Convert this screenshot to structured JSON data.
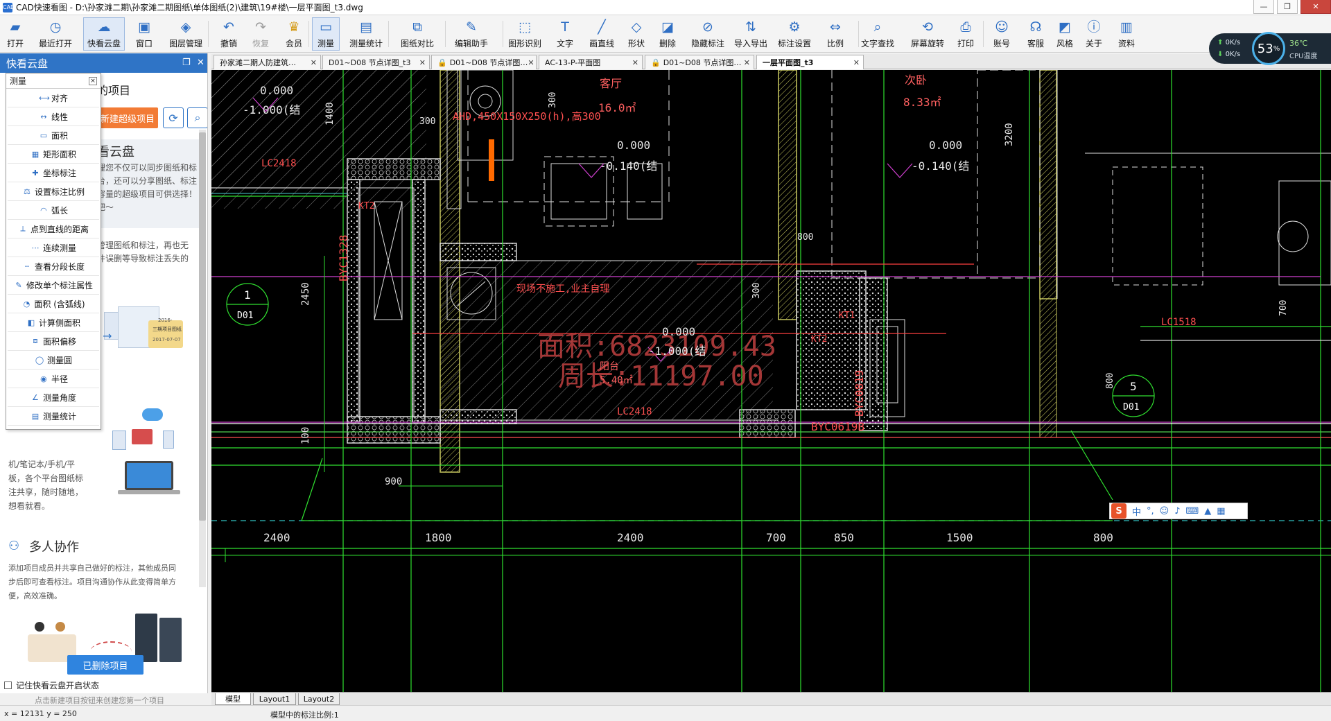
{
  "window": {
    "title": "CAD快速看图 - D:\\孙家滩二期\\孙家滩二期图纸\\单体图纸(2)\\建筑\\19#楼\\一层平面图_t3.dwg",
    "app_icon_text": "CAD"
  },
  "toolbar": {
    "items": [
      {
        "label": "打开",
        "icon": "folder-icon"
      },
      {
        "label": "最近打开",
        "icon": "recent-icon"
      },
      {
        "label": "快看云盘",
        "icon": "cloud-icon"
      },
      {
        "label": "窗口",
        "icon": "window-icon"
      },
      {
        "label": "图层管理",
        "icon": "layers-icon"
      },
      {
        "label": "撤销",
        "icon": "undo-icon"
      },
      {
        "label": "恢复",
        "icon": "redo-icon"
      },
      {
        "label": "会员",
        "icon": "vip-icon"
      },
      {
        "label": "测量",
        "icon": "measure-icon"
      },
      {
        "label": "测量统计",
        "icon": "measure-stats-icon"
      },
      {
        "label": "图纸对比",
        "icon": "compare-icon"
      },
      {
        "label": "编辑助手",
        "icon": "edit-assistant-icon"
      },
      {
        "label": "图形识别",
        "icon": "shape-recognize-icon"
      },
      {
        "label": "文字",
        "icon": "text-icon"
      },
      {
        "label": "画直线",
        "icon": "line-icon"
      },
      {
        "label": "形状",
        "icon": "shape-icon"
      },
      {
        "label": "删除",
        "icon": "eraser-icon"
      },
      {
        "label": "隐藏标注",
        "icon": "hide-annotation-icon"
      },
      {
        "label": "导入导出",
        "icon": "import-export-icon"
      },
      {
        "label": "标注设置",
        "icon": "annotation-settings-icon"
      },
      {
        "label": "比例",
        "icon": "scale-icon"
      },
      {
        "label": "文字查找",
        "icon": "text-search-icon"
      },
      {
        "label": "屏幕旋转",
        "icon": "rotate-screen-icon"
      },
      {
        "label": "打印",
        "icon": "print-icon"
      },
      {
        "label": "账号",
        "icon": "account-icon"
      },
      {
        "label": "客服",
        "icon": "headset-icon"
      },
      {
        "label": "风格",
        "icon": "style-icon"
      },
      {
        "label": "关于",
        "icon": "info-icon"
      },
      {
        "label": "资料",
        "icon": "docs-icon"
      }
    ]
  },
  "sysmon": {
    "up": "0K/s",
    "down": "0K/s",
    "cpu_percent": "53",
    "percent_sign": "%",
    "temp": "36℃",
    "cpu_label": "CPU温度"
  },
  "sidebar": {
    "title": "快看云盘",
    "my_projects": "的项目",
    "new_project": "新建超级项目",
    "heading1": "看云盘",
    "desc1": "理您不仅可以同步图纸和标\n台，还可以分享图纸、标注\n容量的超级项目可供选择！\n吧～",
    "desc2": "管理图纸和标注，再也无\n件误删等导致标注丢失的",
    "illus_card_title": "三期项目图纸",
    "illus_card_date1": "2016-",
    "illus_card_date2": "2017-07-07",
    "desc3": "机/笔记本/手机/平\n板，各个平台图纸标\n注共享，随时随地，\n想看就看。",
    "heading2": "多人协作",
    "desc4": "添加项目成员并共享自己做好的标注，其他成员同\n步后即可查看标注。项目沟通协作从此变得简单方\n便，高效准确。",
    "deleted_btn": "已删除项目",
    "remember": "记住快看云盘开启状态",
    "hint": "点击新建项目按钮来创建您第一个项目"
  },
  "measure_menu": {
    "title": "测量",
    "items": [
      {
        "label": "对齐",
        "icon": "align-measure-icon"
      },
      {
        "label": "线性",
        "icon": "linear-measure-icon"
      },
      {
        "label": "面积",
        "icon": "area-icon"
      },
      {
        "label": "矩形面积",
        "icon": "rect-area-icon"
      },
      {
        "label": "坐标标注",
        "icon": "coordinate-icon"
      },
      {
        "label": "设置标注比例",
        "icon": "set-scale-icon"
      },
      {
        "label": "弧长",
        "icon": "arc-length-icon"
      },
      {
        "label": "点到直线的距离",
        "icon": "point-line-distance-icon"
      },
      {
        "label": "连续测量",
        "icon": "continuous-measure-icon"
      },
      {
        "label": "查看分段长度",
        "icon": "segment-length-icon"
      },
      {
        "label": "修改单个标注属性",
        "icon": "edit-annotation-icon"
      },
      {
        "label": "面积 (含弧线)",
        "icon": "arc-area-icon"
      },
      {
        "label": "计算侧面积",
        "icon": "side-area-icon"
      },
      {
        "label": "面积偏移",
        "icon": "area-offset-icon"
      },
      {
        "label": "测量圆",
        "icon": "circle-measure-icon"
      },
      {
        "label": "半径",
        "icon": "radius-icon"
      },
      {
        "label": "测量角度",
        "icon": "angle-icon"
      },
      {
        "label": "测量统计",
        "icon": "stats-icon"
      }
    ]
  },
  "tabs": [
    {
      "label": "孙家滩二期人防建筑…",
      "locked": false,
      "active": false
    },
    {
      "label": "D01~D08 节点详图_t3",
      "locked": false,
      "active": false
    },
    {
      "label": "D01~D08 节点详图…",
      "locked": true,
      "active": false
    },
    {
      "label": "AC-13-P-平面图",
      "locked": false,
      "active": false
    },
    {
      "label": "D01~D08 节点详图…",
      "locked": true,
      "active": false
    },
    {
      "label": "一层平面图_t3",
      "locked": false,
      "active": true
    }
  ],
  "layout_tabs": [
    "模型",
    "Layout1",
    "Layout2"
  ],
  "status": {
    "coords": "x = 12131  y = 250",
    "scale_text": "模型中的标注比例:1"
  },
  "ime": {
    "lang": "中",
    "punct": "°,"
  },
  "drawing": {
    "area_text": "面积:6823109.43",
    "perimeter_text": "周长:11197.00",
    "elevations": [
      "0.000",
      "-1.000(结",
      "0.000",
      "-0.140(结",
      "0.000",
      "-0.140(结",
      "0.000",
      "-1.000(结"
    ],
    "room_labels": [
      "客厅",
      "16.0㎡",
      "次卧",
      "8.33㎡",
      "阳台",
      "5.40㎡"
    ],
    "notes": [
      "AHD,450X150X250(h),高300",
      "现场不施工,业主自理"
    ],
    "tags": [
      "LC2418",
      "LC2418",
      "LC1518",
      "BYC1328",
      "BYC0619B",
      "BYC0819",
      "KT2",
      "KT2",
      "KT1"
    ],
    "axis_circles": [
      {
        "num": "1",
        "code": "D01"
      },
      {
        "num": "5",
        "code": "D01"
      }
    ],
    "dims_bottom": [
      "2400",
      "1800",
      "2400",
      "700",
      "850",
      "1500",
      "800"
    ],
    "dims_misc": [
      "1400",
      "3200",
      "2450",
      "100",
      "900",
      "300",
      "800",
      "300",
      "300",
      "700",
      "800"
    ]
  }
}
